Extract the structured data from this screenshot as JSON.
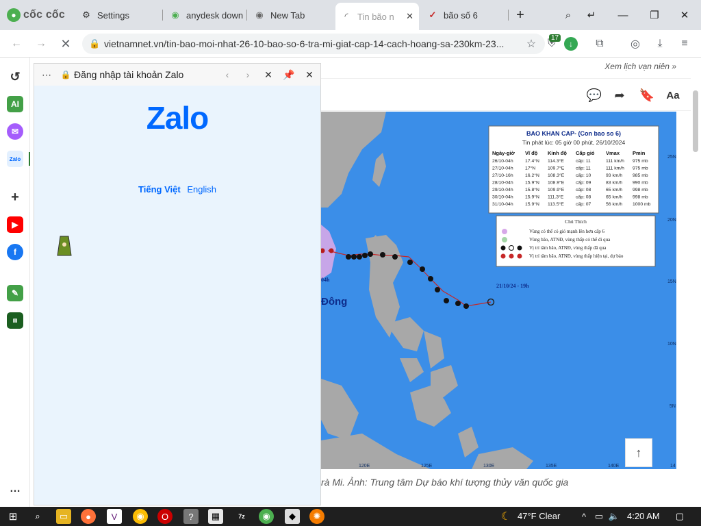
{
  "browser": {
    "brand": "cốc cốc",
    "tabs": [
      {
        "label": "Settings",
        "icon": "gear-icon"
      },
      {
        "label": "anydesk down",
        "icon": "coccoc-icon"
      },
      {
        "label": "New Tab",
        "icon": "coccoc-icon"
      },
      {
        "label": "Tin bão n",
        "icon": "loading-spinner-icon",
        "active": true
      },
      {
        "label": "bão số 6",
        "icon": "vietnamnet-icon"
      }
    ],
    "new_tab": "+",
    "url": "vietnamnet.vn/tin-bao-moi-nhat-26-10-bao-so-6-tra-mi-giat-cap-14-cach-hoang-sa-230km-23...",
    "extension_badge": "17"
  },
  "zalo_panel": {
    "title": "Đăng nhập tài khoản Zalo",
    "logo": "Zalo",
    "lang_vi": "Tiếng Việt",
    "lang_en": "English"
  },
  "page": {
    "calendar_link": "Xem lịch vạn niên »",
    "caption": "rà Mi. Ảnh: Trung tâm Dự báo khí tượng thủy văn quốc gia"
  },
  "map": {
    "box_title": "BAO KHAN CAP- (Con bao so 6)",
    "box_subtitle": "Tin phát lúc: 05 giờ 00 phút, 26/10/2024",
    "table_headers": [
      "Ngày-giờ",
      "Vĩ độ",
      "Kinh độ",
      "Cấp gió",
      "Vmax",
      "Pmin"
    ],
    "table_rows": [
      [
        "26/10-04h",
        "17.4°N",
        "114.3°E",
        "cấp: 11",
        "111 km/h",
        "975 mb"
      ],
      [
        "27/10-04h",
        "17°N",
        "109.7°E",
        "cấp: 11",
        "111 km/h",
        "975 mb"
      ],
      [
        "27/10-16h",
        "16.2°N",
        "108.3°E",
        "cấp: 10",
        "93 km/h",
        "985 mb"
      ],
      [
        "28/10-04h",
        "15.9°N",
        "108.9°E",
        "cấp: 09",
        "83 km/h",
        "990 mb"
      ],
      [
        "29/10-04h",
        "15.8°N",
        "109.9°E",
        "cấp: 08",
        "65 km/h",
        "998 mb"
      ],
      [
        "30/10-04h",
        "15.9°N",
        "111.3°E",
        "cấp: 08",
        "65 km/h",
        "998 mb"
      ],
      [
        "31/10-04h",
        "15.9°N",
        "113.5°E",
        "cấp: 07",
        "56 km/h",
        "1000 mb"
      ]
    ],
    "legend_title": "Chú Thích",
    "legend_items": [
      "Vùng có thể có gió mạnh lên hơn cấp 6",
      "Vùng bão, ATNĐ, vùng thấp có thể đi qua",
      "Vị trí tâm bão, ATNĐ, vùng thấp đã qua",
      "Vị trí tâm bão, ATNĐ, vùng thấp hiện tại, dự báo"
    ],
    "track_start_label": "21/10/24 - 19h",
    "partial_label": "04h",
    "place_label": "Đông",
    "lat_labels": [
      "25N",
      "20N",
      "15N",
      "10N",
      "5N"
    ],
    "lon_labels": [
      "120E",
      "125E",
      "130E",
      "135E",
      "140E",
      "14"
    ]
  },
  "taskbar": {
    "weather": "47°F  Clear",
    "time": "4:20 AM"
  },
  "colors": {
    "tabstrip": "#dee1e6",
    "zalo_blue": "#0068ff",
    "sea": "#3b8ee8",
    "land": "#a8a8a8"
  }
}
